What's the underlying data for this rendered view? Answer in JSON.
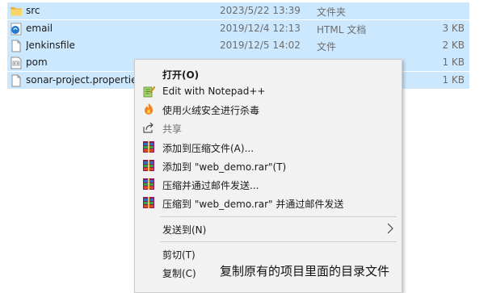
{
  "files": [
    {
      "name": "src",
      "date": "2023/5/22 13:39",
      "type": "文件夹",
      "size": "",
      "icon": "folder-icon"
    },
    {
      "name": "email",
      "date": "2019/12/4 12:13",
      "type": "HTML 文档",
      "size": "3 KB",
      "icon": "edge-html-icon"
    },
    {
      "name": "Jenkinsfile",
      "date": "2019/12/5 14:02",
      "type": "文件",
      "size": "2 KB",
      "icon": "file-icon"
    },
    {
      "name": "pom",
      "date": "",
      "type": "",
      "size": "1 KB",
      "icon": "xml-file-icon"
    },
    {
      "name": "sonar-project.properties",
      "date": "",
      "type": "",
      "size": "1 KB",
      "icon": "file-icon"
    }
  ],
  "context_menu": {
    "open": "打开(O)",
    "edit_notepad": "Edit with Notepad++",
    "antivirus": "使用火绒安全进行杀毒",
    "share": "共享",
    "add_archive": "添加到压缩文件(A)...",
    "add_rar": "添加到 \"web_demo.rar\"(T)",
    "compress_email": "压缩并通过邮件发送...",
    "compress_rar_email": "压缩到 \"web_demo.rar\" 并通过邮件发送",
    "send_to": "发送到(N)",
    "cut": "剪切(T)",
    "copy": "复制(C)"
  },
  "annotation": "复制原有的项目里面的目录文件",
  "colors": {
    "selection": "#cce8ff",
    "menu_bg": "#f2f2f2",
    "folder": "#f4c54a",
    "edge": "#1f7bd1",
    "winrar": "#8b1a5a"
  }
}
